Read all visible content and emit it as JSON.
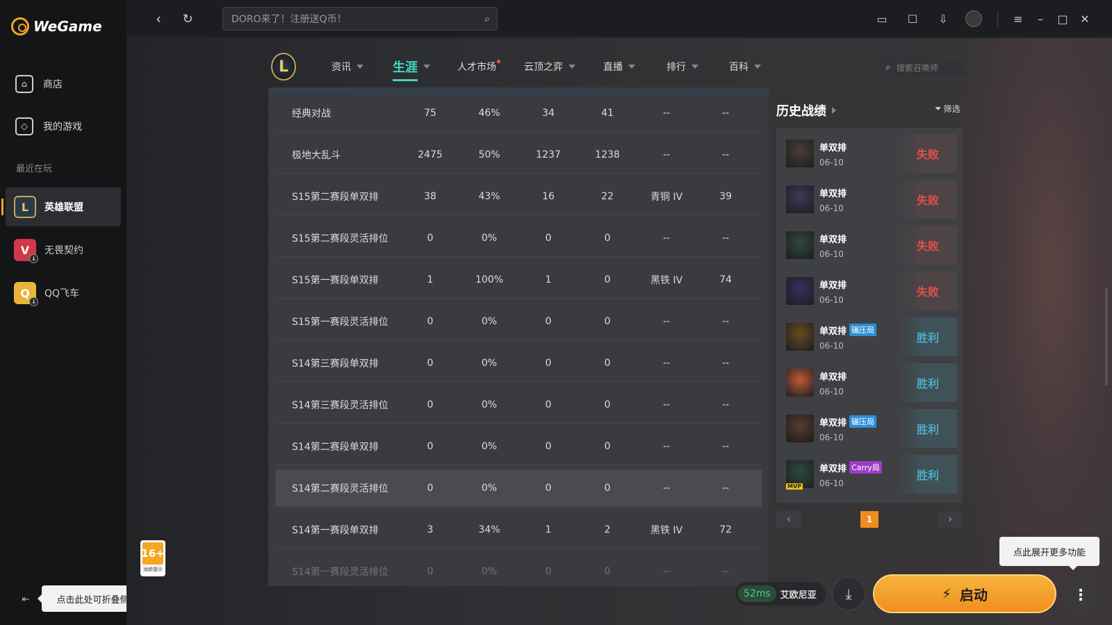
{
  "sidebar": {
    "brand": "WeGame",
    "nav": [
      {
        "label": "商店",
        "icon": "shop-icon"
      },
      {
        "label": "我的游戏",
        "icon": "gamepad-icon"
      }
    ],
    "recent_label": "最近在玩",
    "games": [
      {
        "label": "英雄联盟",
        "active": true,
        "icon_color": "#2a3a46",
        "icon_text": "L"
      },
      {
        "label": "无畏契约",
        "active": false,
        "icon_color": "#d0384a",
        "icon_text": "V"
      },
      {
        "label": "QQ飞车",
        "active": false,
        "icon_color": "#e8b53a",
        "icon_text": "Q"
      }
    ],
    "collapse_tip": "点击此处可折叠侧栏",
    "age_badge": "16+",
    "age_badge_sub": "适龄提示"
  },
  "topbar": {
    "search_placeholder": "DORO来了！注册送Q币！"
  },
  "game_nav": {
    "logo_text": "L",
    "tabs": [
      {
        "label": "资讯",
        "caret": true,
        "active": false,
        "dot": false
      },
      {
        "label": "生涯",
        "caret": true,
        "active": true,
        "dot": false
      },
      {
        "label": "人才市场",
        "caret": false,
        "active": false,
        "dot": true
      },
      {
        "label": "云顶之弈",
        "caret": true,
        "active": false,
        "dot": false
      },
      {
        "label": "直播",
        "caret": true,
        "active": false,
        "dot": false
      },
      {
        "label": "排行",
        "caret": true,
        "active": false,
        "dot": false
      },
      {
        "label": "百科",
        "caret": true,
        "active": false,
        "dot": false
      }
    ],
    "summoner_search_placeholder": "搜索召唤师"
  },
  "stats_table": {
    "rows": [
      {
        "name": "经典对战",
        "games": "75",
        "winrate": "46%",
        "wins": "34",
        "losses": "41",
        "rank": "--",
        "points": "--"
      },
      {
        "name": "极地大乱斗",
        "games": "2475",
        "winrate": "50%",
        "wins": "1237",
        "losses": "1238",
        "rank": "--",
        "points": "--"
      },
      {
        "name": "S15第二赛段单双排",
        "games": "38",
        "winrate": "43%",
        "wins": "16",
        "losses": "22",
        "rank": "青铜 IV",
        "points": "39"
      },
      {
        "name": "S15第二赛段灵活排位",
        "games": "0",
        "winrate": "0%",
        "wins": "0",
        "losses": "0",
        "rank": "--",
        "points": "--"
      },
      {
        "name": "S15第一赛段单双排",
        "games": "1",
        "winrate": "100%",
        "wins": "1",
        "losses": "0",
        "rank": "黑铁 IV",
        "points": "74"
      },
      {
        "name": "S15第一赛段灵活排位",
        "games": "0",
        "winrate": "0%",
        "wins": "0",
        "losses": "0",
        "rank": "--",
        "points": "--"
      },
      {
        "name": "S14第三赛段单双排",
        "games": "0",
        "winrate": "0%",
        "wins": "0",
        "losses": "0",
        "rank": "--",
        "points": "--"
      },
      {
        "name": "S14第三赛段灵活排位",
        "games": "0",
        "winrate": "0%",
        "wins": "0",
        "losses": "0",
        "rank": "--",
        "points": "--"
      },
      {
        "name": "S14第二赛段单双排",
        "games": "0",
        "winrate": "0%",
        "wins": "0",
        "losses": "0",
        "rank": "--",
        "points": "--"
      },
      {
        "name": "S14第二赛段灵活排位",
        "games": "0",
        "winrate": "0%",
        "wins": "0",
        "losses": "0",
        "rank": "--",
        "points": "--"
      },
      {
        "name": "S14第一赛段单双排",
        "games": "3",
        "winrate": "34%",
        "wins": "1",
        "losses": "2",
        "rank": "黑铁 IV",
        "points": "72"
      },
      {
        "name": "S14第一赛段灵活排位",
        "games": "0",
        "winrate": "0%",
        "wins": "0",
        "losses": "0",
        "rank": "--",
        "points": "--"
      }
    ]
  },
  "history": {
    "title": "历史战绩",
    "filter_label": "筛选",
    "matches": [
      {
        "mode": "单双排",
        "date": "06-10",
        "result": "失败",
        "win": false,
        "tag": "",
        "tag_color": "",
        "champ_color": "#4a3d3a",
        "mvp": false
      },
      {
        "mode": "单双排",
        "date": "06-10",
        "result": "失败",
        "win": false,
        "tag": "",
        "tag_color": "",
        "champ_color": "#3b3a5a",
        "mvp": false
      },
      {
        "mode": "单双排",
        "date": "06-10",
        "result": "失败",
        "win": false,
        "tag": "",
        "tag_color": "",
        "champ_color": "#2e4a3c",
        "mvp": false
      },
      {
        "mode": "单双排",
        "date": "06-10",
        "result": "失败",
        "win": false,
        "tag": "",
        "tag_color": "",
        "champ_color": "#3a2e5e",
        "mvp": false
      },
      {
        "mode": "单双排",
        "date": "06-10",
        "result": "胜利",
        "win": true,
        "tag": "碾压局",
        "tag_color": "#2d8fd6",
        "champ_color": "#6a4a22",
        "mvp": false
      },
      {
        "mode": "单双排",
        "date": "06-10",
        "result": "胜利",
        "win": true,
        "tag": "",
        "tag_color": "",
        "champ_color": "#c05a34",
        "mvp": false
      },
      {
        "mode": "单双排",
        "date": "06-10",
        "result": "胜利",
        "win": true,
        "tag": "碾压局",
        "tag_color": "#2d8fd6",
        "champ_color": "#5a3a2c",
        "mvp": false
      },
      {
        "mode": "单双排",
        "date": "06-10",
        "result": "胜利",
        "win": true,
        "tag": "Carry局",
        "tag_color": "#a03cc8",
        "champ_color": "#2e4a3c",
        "mvp": true,
        "mvp_label": "MVP"
      }
    ],
    "page": "1"
  },
  "footer": {
    "ping": "52ms",
    "region": "艾欧尼亚",
    "launch_label": "启动",
    "more_tip": "点此展开更多功能"
  }
}
